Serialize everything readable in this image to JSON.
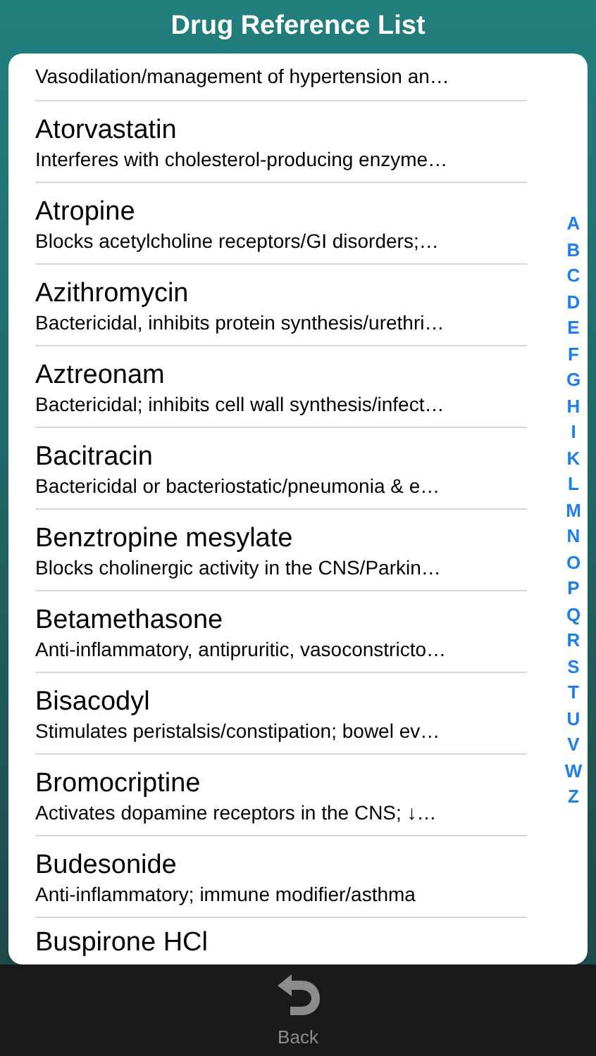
{
  "header": {
    "title": "Drug Reference List"
  },
  "drugs": [
    {
      "description": "Vasodilation/management of hypertension an…"
    },
    {
      "name": "Atorvastatin",
      "description": "Interferes with cholesterol-producing enzyme…"
    },
    {
      "name": "Atropine",
      "description": "Blocks acetylcholine receptors/GI disorders;…"
    },
    {
      "name": "Azithromycin",
      "description": "Bactericidal, inhibits protein synthesis/urethri…"
    },
    {
      "name": "Aztreonam",
      "description": "Bactericidal; inhibits cell wall synthesis/infect…"
    },
    {
      "name": "Bacitracin",
      "description": "Bactericidal or bacteriostatic/pneumonia & e…"
    },
    {
      "name": "Benztropine mesylate",
      "description": "Blocks cholinergic activity in the CNS/Parkin…"
    },
    {
      "name": "Betamethasone",
      "description": "Anti-inflammatory, antipruritic, vasoconstricto…"
    },
    {
      "name": "Bisacodyl",
      "description": "Stimulates peristalsis/constipation; bowel ev…"
    },
    {
      "name": "Bromocriptine",
      "description": "Activates dopamine receptors in the CNS; ↓…"
    },
    {
      "name": "Budesonide",
      "description": "Anti-inflammatory; immune modifier/asthma"
    },
    {
      "name": "Buspirone HCl"
    }
  ],
  "index_letters": [
    "A",
    "B",
    "C",
    "D",
    "E",
    "F",
    "G",
    "H",
    "I",
    "K",
    "L",
    "M",
    "N",
    "O",
    "P",
    "Q",
    "R",
    "S",
    "T",
    "U",
    "V",
    "W",
    "Z"
  ],
  "toolbar": {
    "back_label": "Back"
  }
}
